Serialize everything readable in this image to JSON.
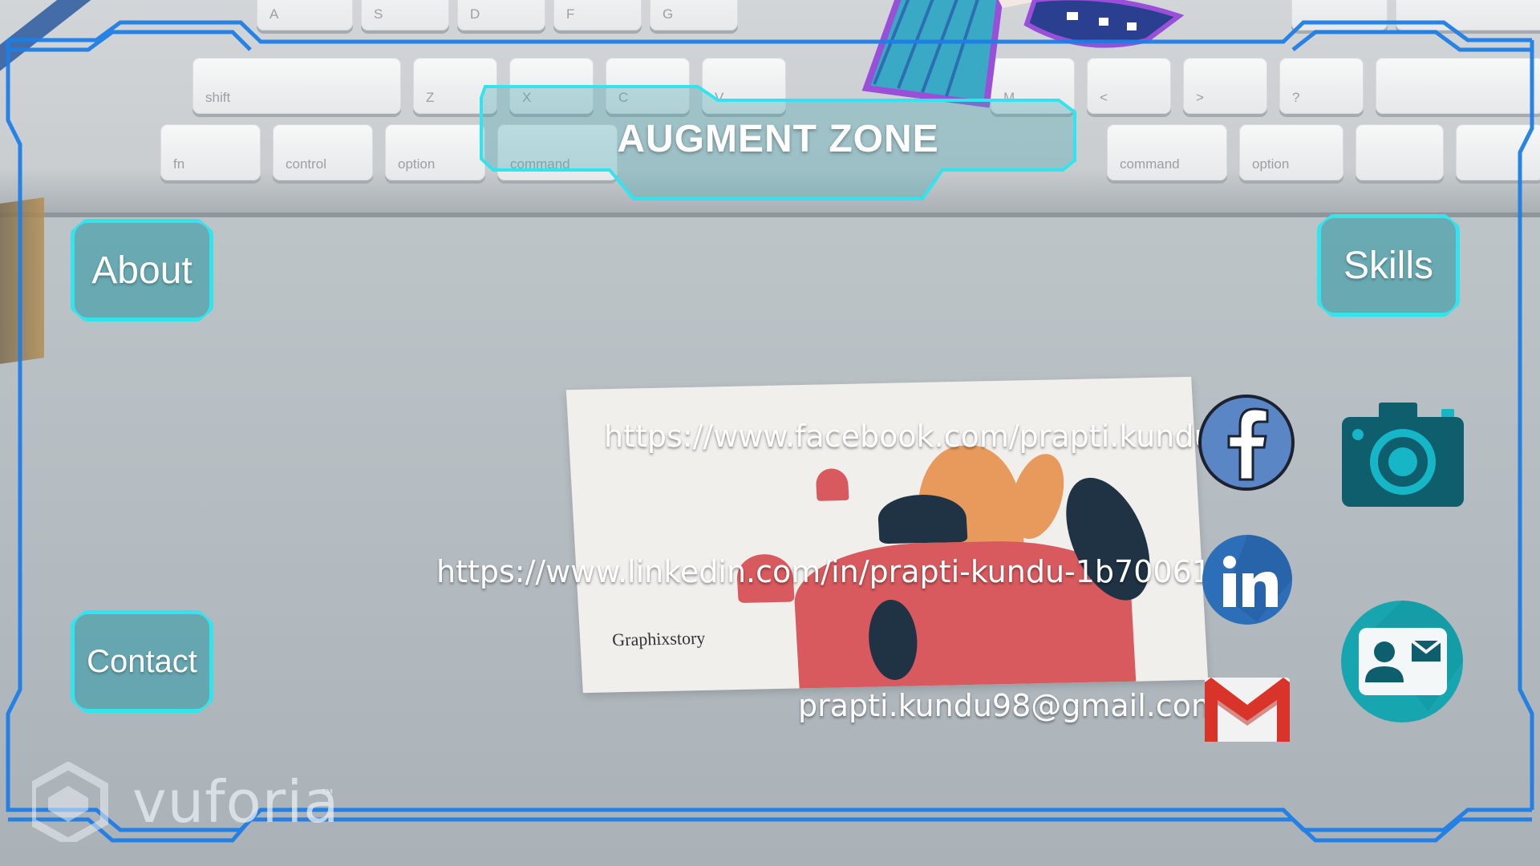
{
  "app": {
    "title": "AUGMENT ZONE"
  },
  "nav": {
    "about_label": "About",
    "skills_label": "Skills",
    "contact_label": "Contact"
  },
  "contacts": {
    "facebook_url": "https://www.facebook.com/prapti.kundu.5",
    "linkedin_url": "https://www.linkedin.com/in/prapti-kundu-1b700612b/",
    "email": "prapti.kundu98@gmail.com"
  },
  "icons": {
    "facebook": "facebook-icon",
    "linkedin": "linkedin-icon",
    "gmail": "gmail-icon",
    "camera": "camera-icon",
    "contact_card": "contact-card-icon"
  },
  "card": {
    "brand": "Graphixstory"
  },
  "watermark": {
    "brand": "vuforia",
    "tm": "™"
  },
  "keyboard": {
    "row1": [
      "A",
      "S",
      "D",
      "F",
      "G"
    ],
    "row2": [
      "Z",
      "X",
      "C",
      "V",
      "M",
      "<",
      ">",
      "?"
    ],
    "row3": [
      "fn",
      "control",
      "option",
      "command",
      "command",
      "option"
    ],
    "row_misc": [
      "shift"
    ]
  },
  "colors": {
    "hud_frame": "#1e7ee6",
    "hud_accent": "#31e4ee",
    "button_fill": "#4aa0aa",
    "facebook_blue": "#5a86c6",
    "linkedin_blue": "#2d6eb8",
    "gmail_red": "#d8342a",
    "camera_teal": "#0f5e6e",
    "contact_teal": "#17a5b0"
  }
}
